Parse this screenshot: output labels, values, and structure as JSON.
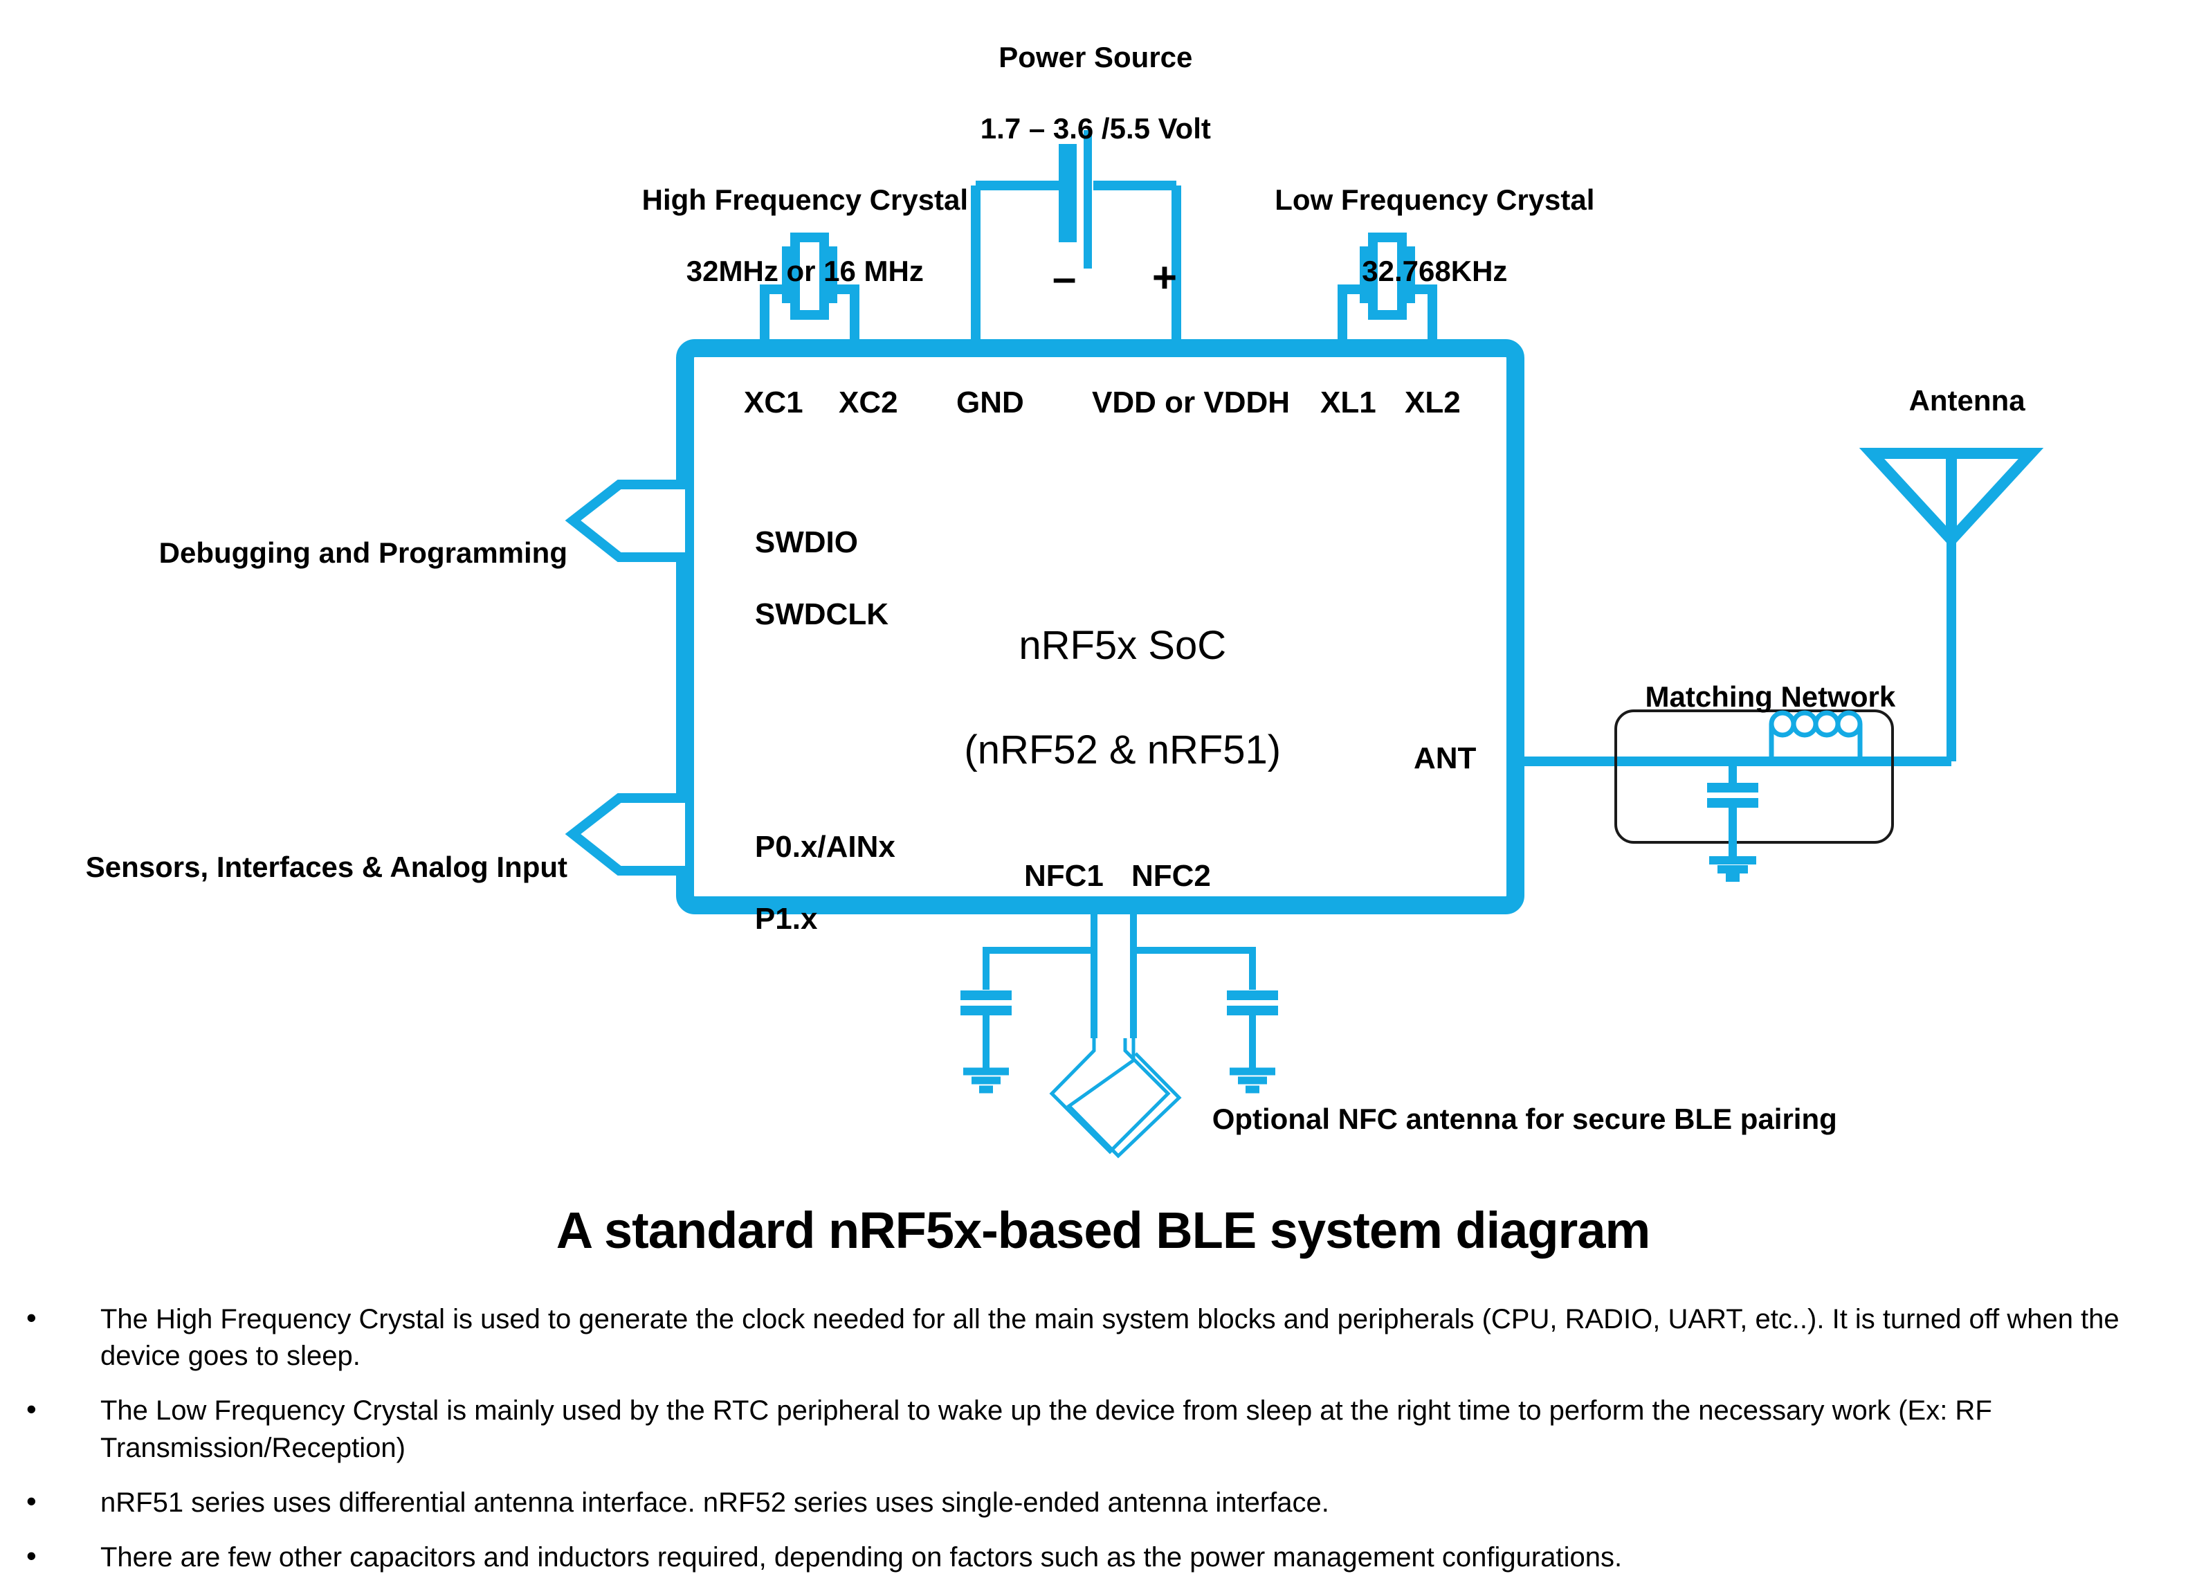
{
  "theme": {
    "accent": "#14AAE4",
    "outline": "#1A1A1A",
    "text": "#000000",
    "background": "#FFFFFF"
  },
  "diagram": {
    "chip": {
      "name_line1": "nRF5x SoC",
      "name_line2": "(nRF52 & nRF51)"
    },
    "annotations": {
      "power_source": {
        "line1": "Power Source",
        "line2": "1.7 – 3.6 /5.5 Volt",
        "minus": "–",
        "plus": "+"
      },
      "hf_crystal": {
        "line1": "High Frequency Crystal",
        "line2": "32MHz or 16 MHz"
      },
      "lf_crystal": {
        "line1": "Low Frequency Crystal",
        "line2": "32.768KHz"
      },
      "antenna": "Antenna",
      "matching_network": "Matching Network",
      "nfc_note": "Optional NFC antenna for secure BLE pairing",
      "debug": "Debugging and Programming",
      "sensors": "Sensors, Interfaces & Analog Input"
    },
    "pins": {
      "top": [
        "XC1",
        "XC2",
        "GND",
        "VDD or VDDH",
        "XL1",
        "XL2"
      ],
      "left_debug": [
        "SWDIO",
        "SWDCLK"
      ],
      "left_io": [
        "P0.x/AINx",
        "P1.x"
      ],
      "right": [
        "ANT"
      ],
      "bottom": [
        "NFC1",
        "NFC2"
      ]
    }
  },
  "caption": "A standard nRF5x-based BLE system diagram",
  "notes": [
    "The High Frequency Crystal is used to generate the clock needed for all the main system blocks and peripherals (CPU, RADIO, UART, etc..). It is turned off when the device goes to sleep.",
    "The Low Frequency Crystal is mainly used by the RTC peripheral to wake up the device from sleep at the right time to perform the necessary work (Ex: RF Transmission/Reception)",
    "nRF51 series uses differential antenna interface. nRF52 series uses single-ended antenna interface.",
    "There are few other capacitors and inductors required, depending on factors such as the power management configurations."
  ]
}
